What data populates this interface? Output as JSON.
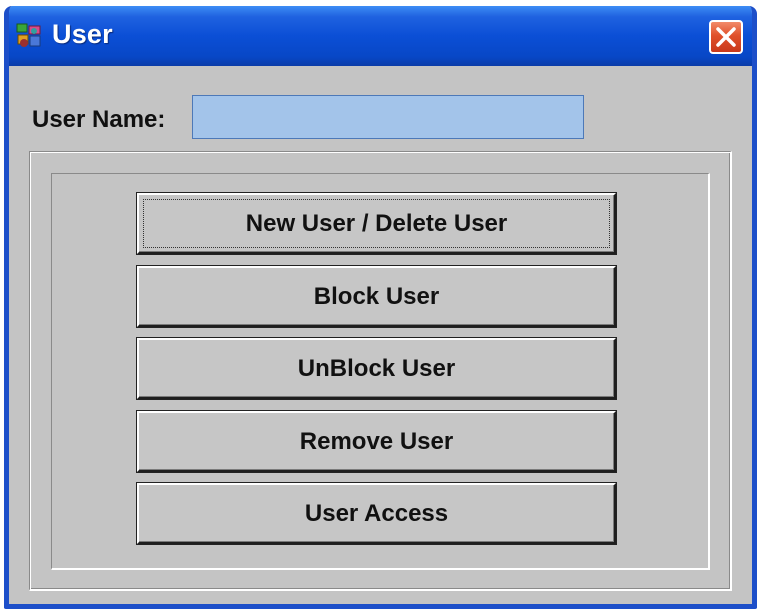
{
  "window": {
    "title": "User",
    "title_bar_color": "#0b4fd6",
    "close_icon": "close-icon",
    "app_icon": "user-app-icon"
  },
  "form": {
    "username_label": "User Name:",
    "username_value": "",
    "username_placeholder": "",
    "input_background": "#a3c4ea"
  },
  "buttons": [
    {
      "label": "New User / Delete User",
      "focused": true
    },
    {
      "label": "Block User"
    },
    {
      "label": "UnBlock User"
    },
    {
      "label": "Remove User"
    },
    {
      "label": "User Access"
    }
  ]
}
